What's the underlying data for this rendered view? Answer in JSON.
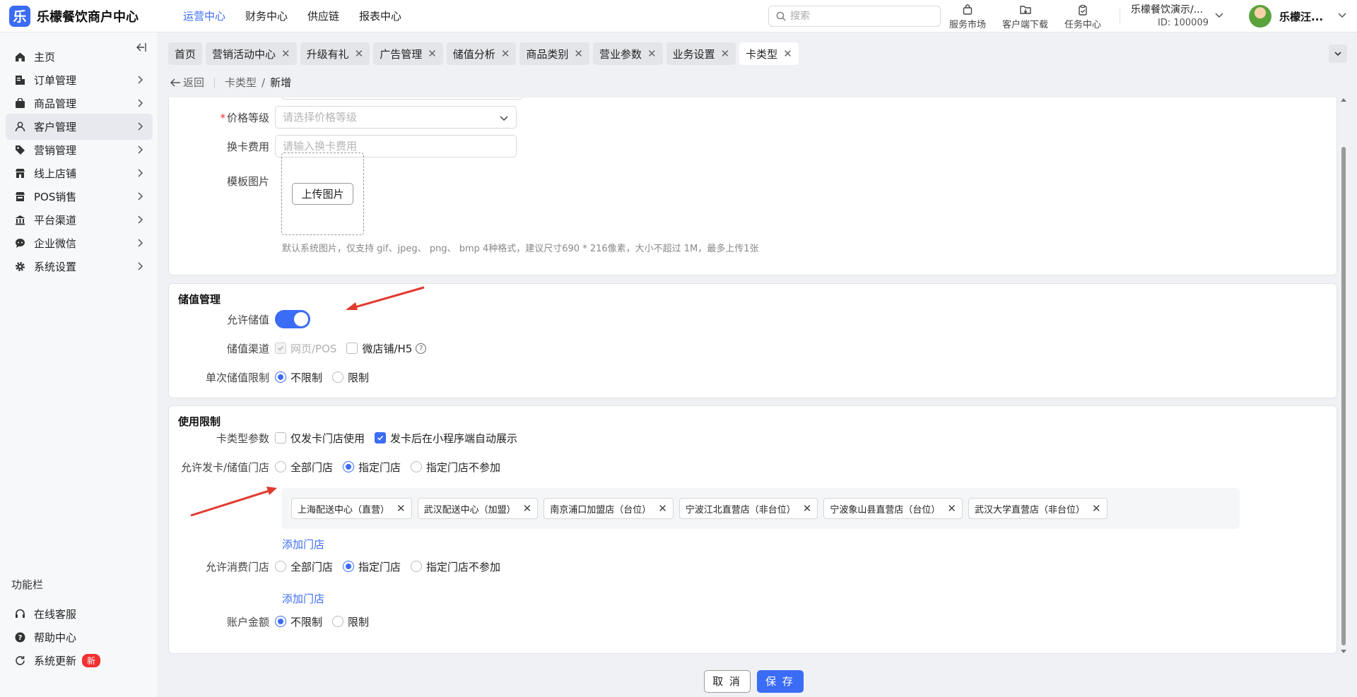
{
  "app": {
    "logo_char": "乐",
    "title": "乐檬餐饮商户中心"
  },
  "topnav": [
    {
      "label": "运营中心",
      "active": true
    },
    {
      "label": "财务中心"
    },
    {
      "label": "供应链"
    },
    {
      "label": "报表中心"
    }
  ],
  "search": {
    "placeholder": "搜索"
  },
  "tools": {
    "market": "服务市场",
    "download": "客户端下载",
    "tasks": "任务中心"
  },
  "tenant": {
    "name": "乐檬餐饮演示/...",
    "id": "ID: 100009"
  },
  "user": {
    "name": "乐檬汪..."
  },
  "sidebar": {
    "items": [
      {
        "label": "主页",
        "icon": "home-icon"
      },
      {
        "label": "订单管理",
        "icon": "order-icon"
      },
      {
        "label": "商品管理",
        "icon": "goods-icon"
      },
      {
        "label": "客户管理",
        "icon": "user-icon",
        "active": true
      },
      {
        "label": "营销管理",
        "icon": "tag-icon"
      },
      {
        "label": "线上店铺",
        "icon": "store-icon"
      },
      {
        "label": "POS销售",
        "icon": "pos-icon"
      },
      {
        "label": "平台渠道",
        "icon": "bank-icon"
      },
      {
        "label": "企业微信",
        "icon": "chat-icon"
      },
      {
        "label": "系统设置",
        "icon": "gear-icon"
      }
    ],
    "section_title": "功能栏",
    "bottom": [
      {
        "label": "在线客服",
        "icon": "headset-icon"
      },
      {
        "label": "帮助中心",
        "icon": "help-icon"
      },
      {
        "label": "系统更新",
        "icon": "refresh-icon",
        "badge": "新"
      }
    ]
  },
  "tabs": [
    {
      "label": "首页",
      "closable": false
    },
    {
      "label": "营销活动中心",
      "closable": true
    },
    {
      "label": "升级有礼",
      "closable": true
    },
    {
      "label": "广告管理",
      "closable": true
    },
    {
      "label": "储值分析",
      "closable": true
    },
    {
      "label": "商品类别",
      "closable": true
    },
    {
      "label": "营业参数",
      "closable": true
    },
    {
      "label": "业务设置",
      "closable": true
    },
    {
      "label": "卡类型",
      "closable": true,
      "active": true
    }
  ],
  "breadcrumb": {
    "back": "返回",
    "parent": "卡类型",
    "sep": "/",
    "current": "新增"
  },
  "basic": {
    "price_level": {
      "label": "价格等级",
      "placeholder": "请选择价格等级"
    },
    "change_fee": {
      "label": "换卡费用",
      "placeholder": "请输入换卡费用"
    },
    "template_image": {
      "label": "模板图片",
      "button": "上传图片",
      "hint": "默认系统图片，仅支持 gif、jpeg、 png、 bmp 4种格式，建议尺寸690 * 216像素，大小不超过 1M，最多上传1张"
    }
  },
  "stored_value": {
    "title": "储值管理",
    "allow_label": "允许储值",
    "channel_label": "储值渠道",
    "channel_web": "网页/POS",
    "channel_shop": "微店铺/H5",
    "single_limit_label": "单次储值限制",
    "no_limit": "不限制",
    "limit": "限制"
  },
  "usage": {
    "title": "使用限制",
    "params_label": "卡类型参数",
    "param_only_issue": "仅发卡门店使用",
    "param_auto_show": "发卡后在小程序端自动展示",
    "issue_store_label": "允许发卡/储值门店",
    "opt_all": "全部门店",
    "opt_specified": "指定门店",
    "opt_exclude": "指定门店不参加",
    "stores": [
      "上海配送中心（直营）",
      "武汉配送中心（加盟）",
      "南京浦口加盟店（台位）",
      "宁波江北直营店（非台位）",
      "宁波象山县直营店（台位）",
      "武汉大学直营店（非台位）"
    ],
    "add_store": "添加门店",
    "consume_store_label": "允许消费门店",
    "account_label": "账户金额",
    "no_limit": "不限制",
    "limit": "限制"
  },
  "footer": {
    "cancel": "取 消",
    "save": "保 存"
  },
  "colors": {
    "primary": "#3b6cf6",
    "annotation_arrow": "#e03a2f"
  }
}
